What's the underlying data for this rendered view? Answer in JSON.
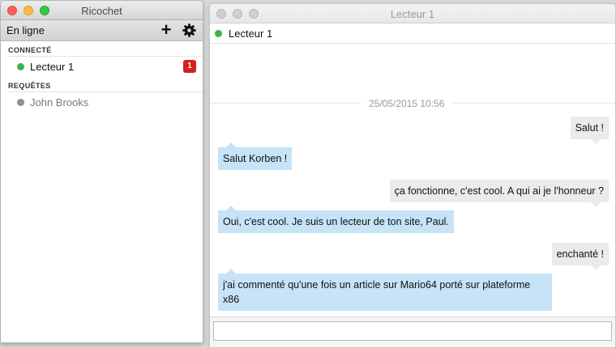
{
  "contacts_window": {
    "title": "Ricochet",
    "status_label": "En ligne",
    "add_icon": "plus-icon",
    "settings_icon": "gear-icon",
    "sections": [
      {
        "header": "CONNECTÉ",
        "contacts": [
          {
            "name": "Lecteur 1",
            "status": "online",
            "unread": "1"
          }
        ]
      },
      {
        "header": "REQUÊTES",
        "contacts": [
          {
            "name": "John Brooks",
            "status": "offline"
          }
        ]
      }
    ]
  },
  "chat_window": {
    "title": "Lecteur 1",
    "contact_name": "Lecteur 1",
    "contact_status": "online",
    "date_separator": "25/05/2015 10:56",
    "messages": [
      {
        "direction": "out",
        "text": "Salut !"
      },
      {
        "direction": "in",
        "text": "Salut Korben !"
      },
      {
        "direction": "out",
        "text": "ça fonctionne, c'est cool. A qui ai je l'honneur ?"
      },
      {
        "direction": "in",
        "text": "Oui, c'est cool. Je suis un lecteur de ton site, Paul."
      },
      {
        "direction": "out",
        "text": "enchanté !"
      },
      {
        "direction": "in",
        "text": "j'ai commenté qu'une fois un article sur Mario64 porté sur plateforme x86"
      }
    ],
    "composer_value": ""
  },
  "colors": {
    "online": "#3cb44b",
    "offline": "#8f8f8f",
    "badge": "#d81f1f",
    "incoming_bubble": "#c6e3f7",
    "outgoing_bubble": "#ebebeb"
  }
}
